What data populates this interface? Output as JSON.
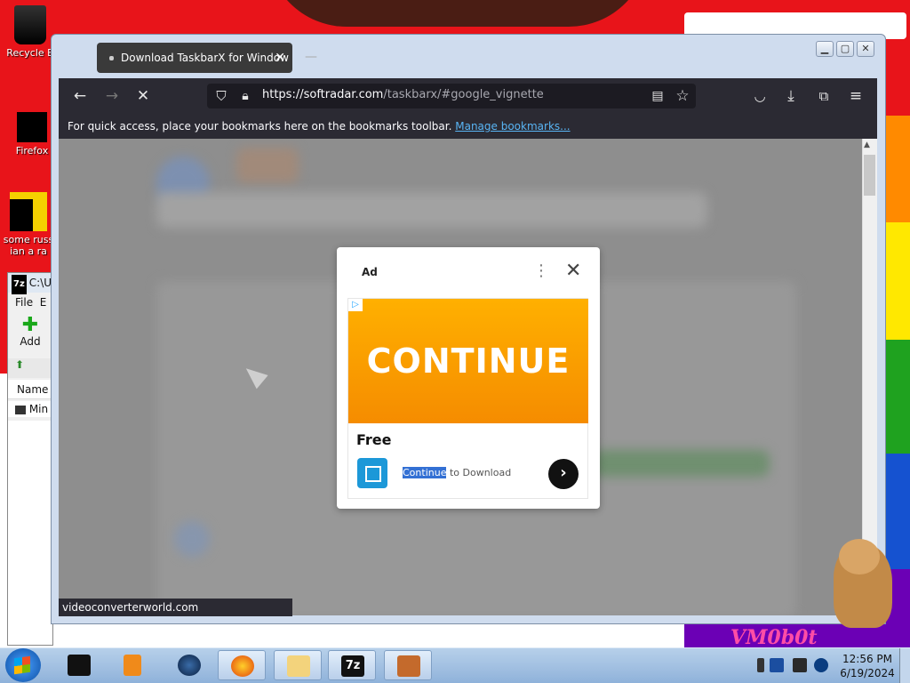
{
  "desktop": {
    "icons": [
      {
        "label": "Recycle B"
      },
      {
        "label": "Firefox"
      },
      {
        "label": "some russ ian a ra"
      }
    ],
    "wallpaper_text": "VM0b0t",
    "stripe_colors": [
      "#ff8a00",
      "#ffe800",
      "#1fa21f",
      "#1552d0",
      "#6b00b5"
    ]
  },
  "sevenzip": {
    "title": "C:\\U",
    "badge": "7z",
    "menu_file": "File",
    "menu_edit": "E",
    "add_label": "Add",
    "col_name": "Name",
    "row_item": "Min"
  },
  "browser": {
    "tab_title": "Download TaskbarX for Window",
    "url_host": "https://softradar.com",
    "url_path": "/taskbarx/#google_vignette",
    "bookmarks_msg": "For quick access, place your bookmarks here on the bookmarks toolbar.",
    "bookmarks_link": "Manage bookmarks...",
    "status_url": "videoconverterworld.com"
  },
  "ad": {
    "label": "Ad",
    "banner_text": "CONTINUE",
    "title": "Free",
    "cta_selected": "Continue",
    "cta_rest": " to Download",
    "brand_color": "#f59a00"
  },
  "taskbar": {
    "time": "12:56 PM",
    "date": "6/19/2024",
    "sevenzip_task": "7z"
  }
}
